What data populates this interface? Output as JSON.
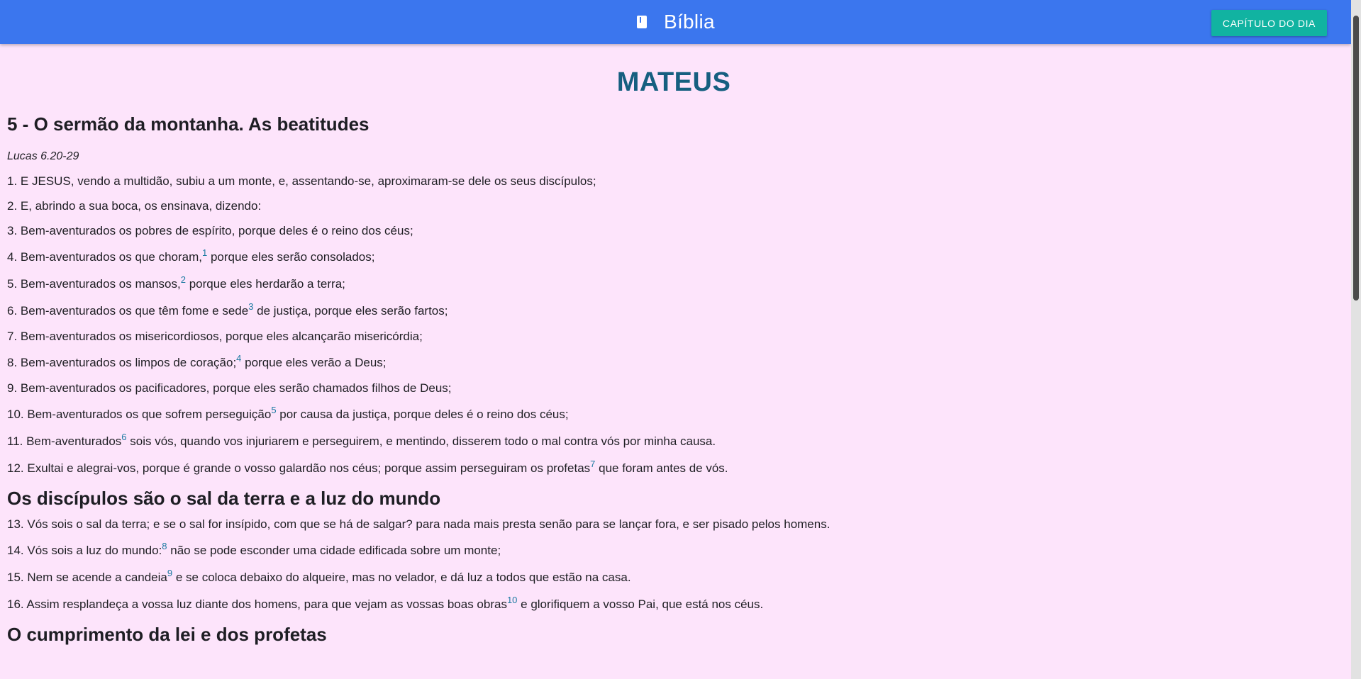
{
  "app": {
    "title": "Bíblia",
    "book_icon": "book-icon",
    "cta_label": "CAPÍTULO DO DIA"
  },
  "colors": {
    "appbar": "#3b76ee",
    "cta": "#11b3a1",
    "background": "#fde4fb",
    "book_title": "#165f80",
    "footnote": "#1b7aa2"
  },
  "book": "MATEUS",
  "sections": [
    {
      "heading": "5 - O sermão da montanha. As beatitudes",
      "reference": "Lucas 6.20-29",
      "verses": [
        {
          "text": "1. E JESUS, vendo a multidão, subiu a um monte, e, assentando-se, aproximaram-se dele os seus discípulos;"
        },
        {
          "text": "2. E, abrindo a sua boca, os ensinava, dizendo:"
        },
        {
          "text": "3. Bem-aventurados os pobres de espírito, porque deles é o reino dos céus;"
        },
        {
          "before": "4. Bem-aventurados os que choram,",
          "note": "1",
          "after": " porque eles serão consolados;"
        },
        {
          "before": "5. Bem-aventurados os mansos,",
          "note": "2",
          "after": " porque eles herdarão a terra;"
        },
        {
          "before": "6. Bem-aventurados os que têm fome e sede",
          "note": "3",
          "after": " de justiça, porque eles serão fartos;"
        },
        {
          "text": "7. Bem-aventurados os misericordiosos, porque eles alcançarão misericórdia;"
        },
        {
          "before": "8. Bem-aventurados os limpos de coração;",
          "note": "4",
          "after": " porque eles verão a Deus;"
        },
        {
          "text": "9. Bem-aventurados os pacificadores, porque eles serão chamados filhos de Deus;"
        },
        {
          "before": "10. Bem-aventurados os que sofrem perseguição",
          "note": "5",
          "after": " por causa da justiça, porque deles é o reino dos céus;"
        },
        {
          "before": "11. Bem-aventurados",
          "note": "6",
          "after": " sois vós, quando vos injuriarem e perseguirem, e mentindo, disserem todo o mal contra vós por minha causa."
        },
        {
          "before": "12. Exultai e alegrai-vos, porque é grande o vosso galardão nos céus; porque assim perseguiram os profetas",
          "note": "7",
          "after": " que foram antes de vós."
        }
      ]
    },
    {
      "heading": "Os discípulos são o sal da terra e a luz do mundo",
      "verses": [
        {
          "text": "13. Vós sois o sal da terra; e se o sal for insípido, com que se há de salgar? para nada mais presta senão para se lançar fora, e ser pisado pelos homens."
        },
        {
          "before": "14. Vós sois a luz do mundo:",
          "note": "8",
          "after": " não se pode esconder uma cidade edificada sobre um monte;"
        },
        {
          "before": "15. Nem se acende a candeia",
          "note": "9",
          "after": " e se coloca debaixo do alqueire, mas no velador, e dá luz a todos que estão na casa."
        },
        {
          "before": "16. Assim resplandeça a vossa luz diante dos homens, para que vejam as vossas boas obras",
          "note": "10",
          "after": " e glorifiquem a vosso Pai, que está nos céus."
        }
      ]
    },
    {
      "heading": "O cumprimento da lei e dos profetas"
    }
  ]
}
